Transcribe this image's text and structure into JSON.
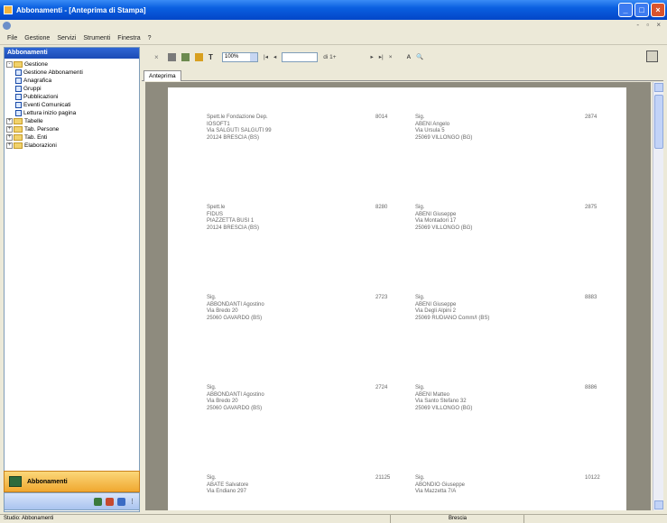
{
  "window": {
    "title": "Abbonamenti - [Anteprima di Stampa]",
    "mdi_controls": "- ▫ ×"
  },
  "menubar": [
    "File",
    "Gestione",
    "Servizi",
    "Strumenti",
    "Finestra",
    "?"
  ],
  "left_panel": {
    "header": "Abbonamenti",
    "tree": [
      {
        "label": "Gestione",
        "level": 0,
        "kind": "folder",
        "expander": "-"
      },
      {
        "label": "Gestione Abbonamenti",
        "level": 1,
        "kind": "item"
      },
      {
        "label": "Anagrafica",
        "level": 1,
        "kind": "item"
      },
      {
        "label": "Gruppi",
        "level": 1,
        "kind": "item"
      },
      {
        "label": "Pubblicazioni",
        "level": 1,
        "kind": "item"
      },
      {
        "label": "Eventi Comunicati",
        "level": 1,
        "kind": "item"
      },
      {
        "label": "Lettura inizio pagina",
        "level": 1,
        "kind": "item"
      },
      {
        "label": "Tabelle",
        "level": 0,
        "kind": "folder",
        "expander": "+"
      },
      {
        "label": "Tab. Persone",
        "level": 0,
        "kind": "folder",
        "expander": "+"
      },
      {
        "label": "Tab. Enti",
        "level": 0,
        "kind": "folder",
        "expander": "+"
      },
      {
        "label": "Elaborazioni",
        "level": 0,
        "kind": "folder",
        "expander": "+"
      }
    ],
    "nav_button": "Abbonamenti"
  },
  "toolbar": {
    "zoom_value": "100%",
    "of_label": "di 1+"
  },
  "tab": "Anteprima",
  "labels": [
    {
      "left": [
        "Spett.le Fondazione Dep.",
        "IOSOFT1",
        "Via SALGUTI SALGUTI 99",
        "20124 BRESCIA (BS)"
      ],
      "left_code": "8014",
      "right": [
        "Sig.",
        "ABENI Angelo",
        "Via Ursula 5",
        "25069 VILLONGO (BG)"
      ],
      "right_code": "2874"
    },
    {
      "left": [
        "Spett.le",
        "FIDUS",
        "PIAZZETTA BUSI 1",
        "20124 BRESCIA (BS)"
      ],
      "left_code": "8280",
      "right": [
        "Sig.",
        "ABENI Giuseppe",
        "Via Montadori 17",
        "25069 VILLONGO (BG)"
      ],
      "right_code": "2875"
    },
    {
      "left": [
        "Sig.",
        "ABBONDANTI Agostino",
        "Via Bredo 20",
        "25060 GAVARDO (BS)"
      ],
      "left_code": "2723",
      "right": [
        "Sig.",
        "ABENI Giuseppe",
        "Via Degli Alpini 2",
        "25069 RUDIANO Comm/I (BS)"
      ],
      "right_code": "8883"
    },
    {
      "left": [
        "Sig.",
        "ABBONDANTI Agostino",
        "Via Bredo 20",
        "25060 GAVARDO (BS)"
      ],
      "left_code": "2724",
      "right": [
        "Sig.",
        "ABENI Matteo",
        "Via Santo Stefano 32",
        "25069 VILLONGO (BG)"
      ],
      "right_code": "8886"
    },
    {
      "left": [
        "Sig.",
        "ABATE Salvatore",
        "Via Endiano 297"
      ],
      "left_code": "21125",
      "right": [
        "Sig.",
        "ABONDIO Giuseppe",
        "Via Mazzetta 7/A"
      ],
      "right_code": "10122"
    }
  ],
  "statusbar": {
    "left": "Studio: Abbonamenti",
    "mid": "Brescia"
  }
}
